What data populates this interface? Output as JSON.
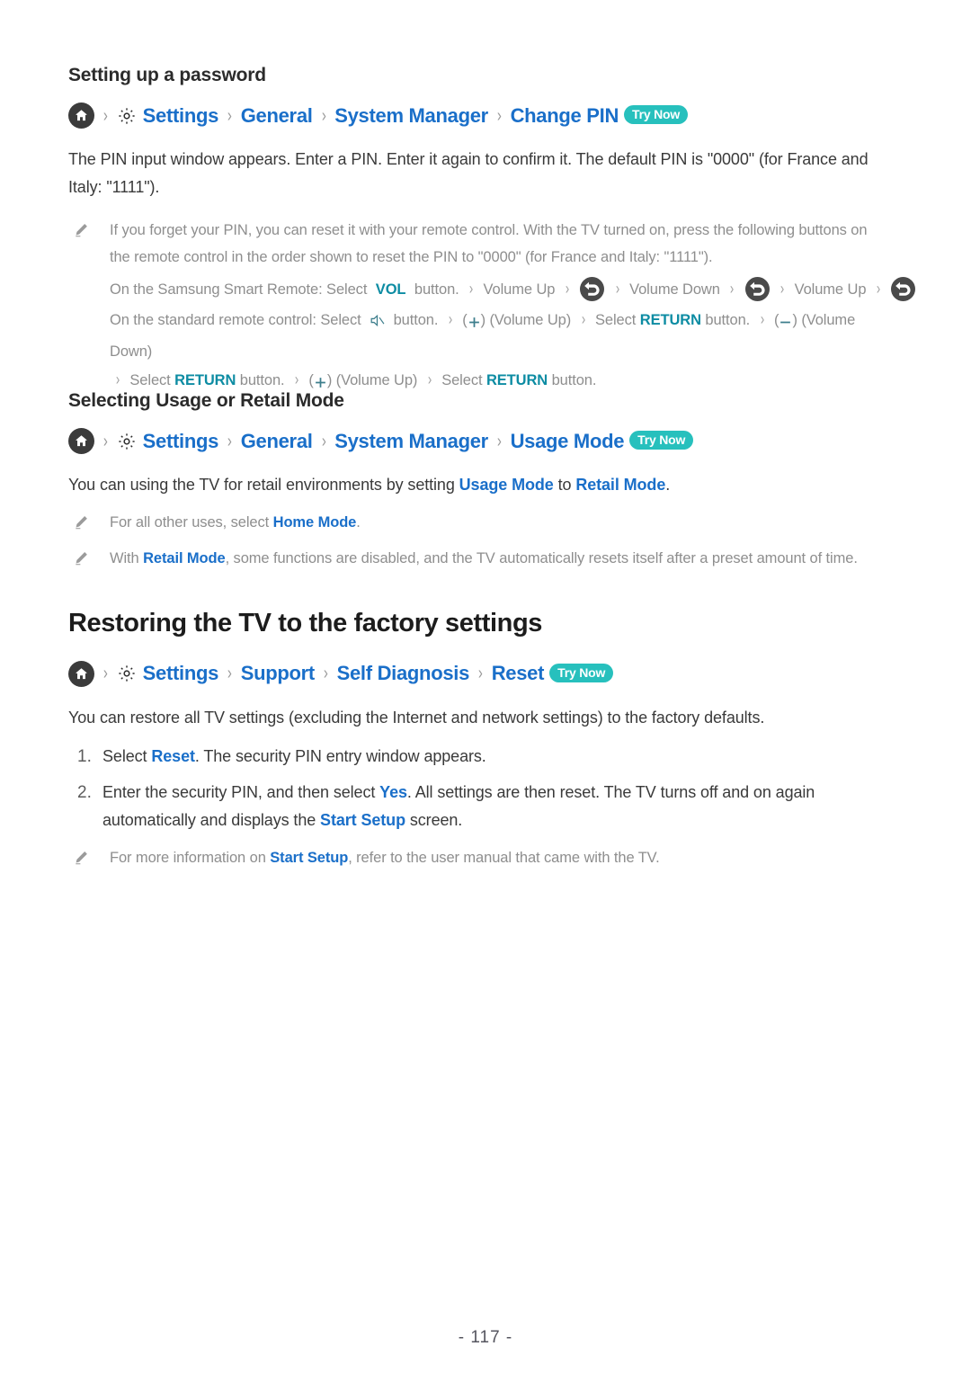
{
  "document": {
    "page_number": "- 117 -"
  },
  "section_password": {
    "heading": "Setting up a password",
    "breadcrumb": {
      "home_icon": "home-icon",
      "gear_icon": "gear-icon",
      "items": [
        "Settings",
        "General",
        "System Manager",
        "Change PIN"
      ],
      "separator": "›",
      "try_now": "Try Now"
    },
    "paragraph": "The PIN input window appears. Enter a PIN. Enter it again to confirm it. The default PIN is \"0000\" (for France and Italy: \"1111\").",
    "note": {
      "icon": "pencil-icon",
      "line1": "If you forget your PIN, you can reset it with your remote control. With the TV turned on, press the following buttons on the remote control in the order shown to reset the PIN to \"0000\" (for France and Italy: \"1111\").",
      "smart_remote": {
        "prefix": "On the Samsung Smart Remote: Select",
        "key": "VOL",
        "suffix": "button.",
        "steps": [
          "Volume Up",
          "return-icon",
          "Volume Down",
          "return-icon",
          "Volume Up",
          "return-icon"
        ]
      },
      "standard_remote": {
        "prefix": "On the standard remote control: Select",
        "mute_icon": "mute-icon",
        "suffix": "button.",
        "seq": [
          {
            "icon": "plus-icon",
            "label": "(Volume Up)"
          },
          {
            "text_pre": "Select",
            "key": "RETURN",
            "text_post": "button."
          },
          {
            "icon": "minus-icon",
            "label": "(Volume Down)"
          },
          {
            "text_pre": "Select",
            "key": "RETURN",
            "text_post": "button."
          },
          {
            "icon": "plus-icon",
            "label": "(Volume Up)"
          },
          {
            "text_pre": "Select",
            "key": "RETURN",
            "text_post": "button."
          }
        ]
      }
    }
  },
  "section_usage": {
    "heading": "Selecting Usage or Retail Mode",
    "breadcrumb": {
      "home_icon": "home-icon",
      "gear_icon": "gear-icon",
      "items": [
        "Settings",
        "General",
        "System Manager",
        "Usage Mode"
      ],
      "try_now": "Try Now"
    },
    "paragraph": {
      "pre": "You can using the TV for retail environments by setting ",
      "link1": "Usage Mode",
      "mid": " to ",
      "link2": "Retail Mode",
      "post": "."
    },
    "notes": [
      {
        "icon": "pencil-icon",
        "pre": "For all other uses, select ",
        "link": "Home Mode",
        "post": "."
      },
      {
        "icon": "pencil-icon",
        "pre": "With ",
        "link": "Retail Mode",
        "post": ", some functions are disabled, and the TV automatically resets itself after a preset amount of time."
      }
    ]
  },
  "section_restore": {
    "heading": "Restoring the TV to the factory settings",
    "breadcrumb": {
      "home_icon": "home-icon",
      "gear_icon": "gear-icon",
      "items": [
        "Settings",
        "Support",
        "Self Diagnosis",
        "Reset"
      ],
      "try_now": "Try Now"
    },
    "paragraph": "You can restore all TV settings (excluding the Internet and network settings) to the factory defaults.",
    "steps": [
      {
        "number": "1.",
        "pre": "Select ",
        "link": "Reset",
        "post": ". The security PIN entry window appears."
      },
      {
        "number": "2.",
        "pre": "Enter the security PIN, and then select ",
        "link": "Yes",
        "mid": ". All settings are then reset. The TV turns off and on again automatically and displays the ",
        "link2": "Start Setup",
        "post": " screen."
      }
    ],
    "note": {
      "icon": "pencil-icon",
      "pre": "For more information on ",
      "link": "Start Setup",
      "post": ", refer to the user manual that came with the TV."
    }
  },
  "colors": {
    "link_blue": "#1a6fc9",
    "teal_accent": "#0d8ca3",
    "badge_teal": "#27c0bd",
    "note_gray": "#8e8e8e",
    "icon_dark": "#3b3b3b"
  }
}
